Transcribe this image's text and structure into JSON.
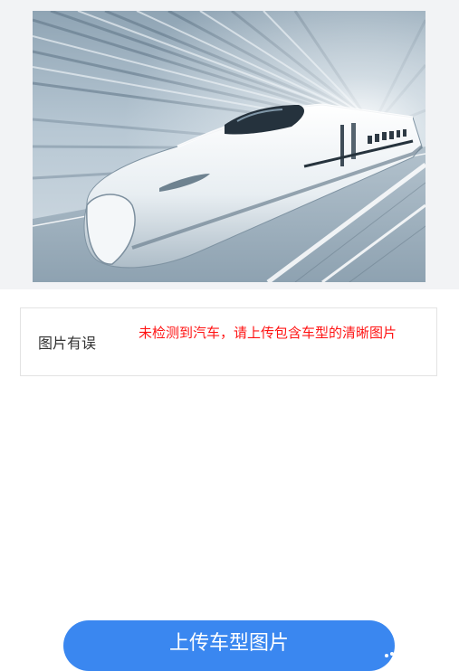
{
  "photo": {
    "subject": "high-speed-train"
  },
  "result": {
    "label": "图片有误",
    "message": "未检测到汽车，请上传包含车型的清晰图片",
    "message_color": "#ff1414"
  },
  "action": {
    "upload_label": "上传车型图片",
    "button_color": "#3a87f0"
  }
}
